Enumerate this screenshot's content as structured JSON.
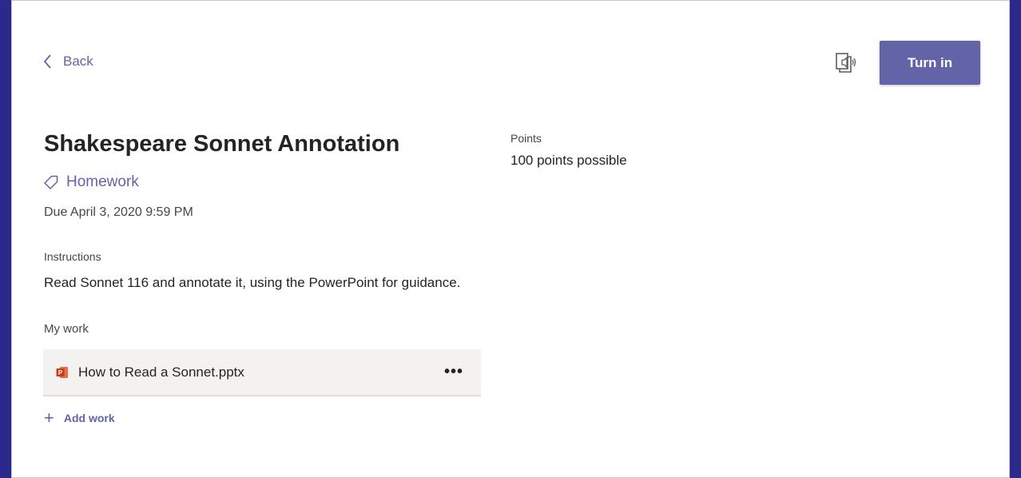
{
  "nav": {
    "back_label": "Back"
  },
  "toolbar": {
    "immersive_reader_icon": "immersive-reader-icon",
    "turn_in_label": "Turn in"
  },
  "assignment": {
    "title": "Shakespeare Sonnet Annotation",
    "category": "Homework",
    "due": "Due April 3, 2020 9:59 PM",
    "instructions_label": "Instructions",
    "instructions_text": "Read Sonnet 116 and annotate it, using the PowerPoint for guidance.",
    "my_work_label": "My work",
    "files": [
      {
        "name": "How to Read a Sonnet.pptx",
        "icon": "powerpoint-icon",
        "more": "•••"
      }
    ],
    "add_work_label": "Add work",
    "add_work_icon": "+"
  },
  "points": {
    "label": "Points",
    "value": "100 points possible"
  },
  "colors": {
    "accent": "#6264a7",
    "background_frame": "#2b2a8c"
  }
}
